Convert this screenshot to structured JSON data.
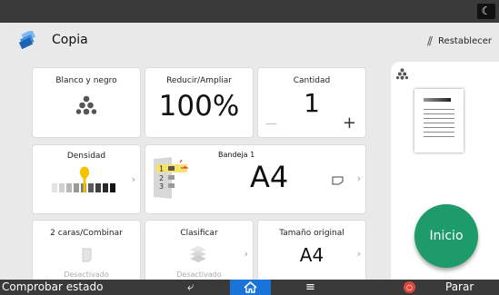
{
  "app": {
    "title": "Copia",
    "icon": "copy-app-icon"
  },
  "header": {
    "reset_label": "Restablecer",
    "night_mode_icon": "moon-icon"
  },
  "tiles": {
    "color": {
      "label": "Blanco y negro",
      "icon": "color-mode-icon"
    },
    "reduce": {
      "label": "Reducir/Ampliar",
      "value": "100%"
    },
    "quantity": {
      "label": "Cantidad",
      "value": "1",
      "minus": "—",
      "plus": "+"
    },
    "density": {
      "label": "Densidad",
      "level": 0.5,
      "steps": 9
    },
    "tray": {
      "label": "Bandeja 1",
      "value": "A4",
      "tray_numbers": [
        "1",
        "2",
        "3"
      ],
      "icon": "paper-tray-icon"
    },
    "duplex": {
      "label": "2 caras/Combinar",
      "sub": "Desactivado"
    },
    "sort": {
      "label": "Clasificar",
      "sub": "Desactivado"
    },
    "original_size": {
      "label": "Tamaño original",
      "value": "A4"
    }
  },
  "preview": {
    "icon": "color-mode-icon"
  },
  "start_button": {
    "label": "Inicio",
    "color": "#1e9b6a"
  },
  "bottombar": {
    "status_label": "Comprobar estado",
    "back_icon": "back-arrow-icon",
    "home_icon": "home-icon",
    "menu_icon": "menu-icon",
    "stop_label": "Parar",
    "home_color": "#1a73d9",
    "stop_color": "#e0473a"
  }
}
